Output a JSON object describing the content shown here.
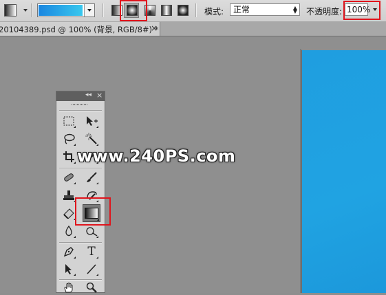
{
  "options_bar": {
    "mode_label": "模式:",
    "mode_value": "正常",
    "opacity_label": "不透明度:",
    "opacity_value": "100%",
    "gradient_colors": [
      "#1a86e0",
      "#39c8ee"
    ],
    "gradient_types": [
      "linear-gradient",
      "radial-gradient",
      "angle-gradient",
      "reflected-gradient",
      "diamond-gradient"
    ],
    "selected_gradient_type": "radial-gradient"
  },
  "document_tab": {
    "title": "20104389.psd @ 100% (背景, RGB/8#) *",
    "close": "×"
  },
  "tools_panel": {
    "collapse": "◂◂",
    "close": "×",
    "tools": [
      [
        "rectangular-marquee",
        "move"
      ],
      [
        "lasso",
        "magic-wand"
      ],
      [
        "crop",
        "eyedropper"
      ],
      [
        "healing-brush",
        "brush"
      ],
      [
        "clone-stamp",
        "history-brush"
      ],
      [
        "eraser",
        "gradient"
      ],
      [
        "blur",
        "dodge"
      ],
      [
        "pen",
        "type"
      ],
      [
        "path-selection",
        "line"
      ],
      [
        "hand",
        "zoom"
      ]
    ],
    "active_tool": "gradient",
    "type_tool_glyph": "T"
  },
  "watermark": "www.240PS.com",
  "colors": {
    "highlight": "#e0141c",
    "canvas_fill": "#1f9ee0",
    "workspace": "#8e8e8e"
  }
}
